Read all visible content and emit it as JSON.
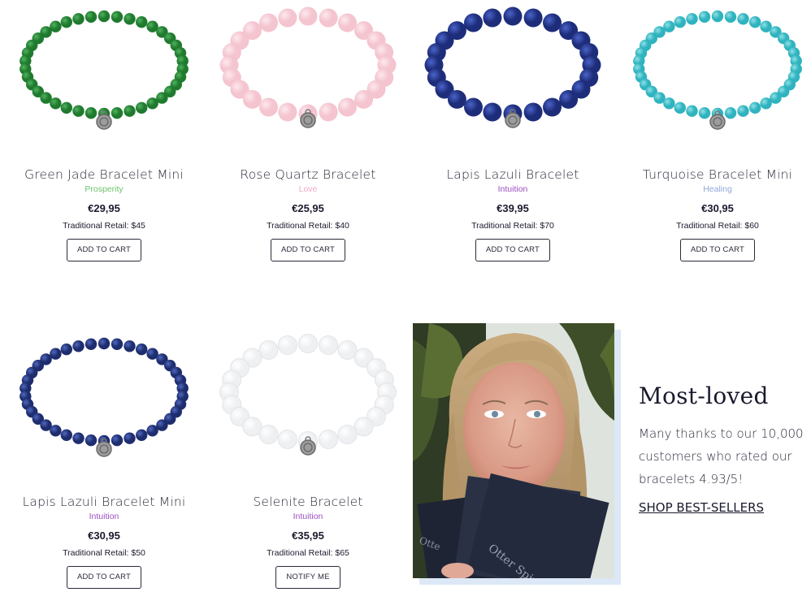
{
  "products": [
    {
      "name": "Green Jade Bracelet Mini",
      "tag": "Prosperity",
      "tag_color": "#6cc36c",
      "price": "€29,95",
      "retail": "Traditional Retail: $45",
      "button": "ADD TO CART",
      "bead_color": "#1f7a2e",
      "bead_hi": "#4fb35f",
      "style": "mini"
    },
    {
      "name": "Rose Quartz Bracelet",
      "tag": "Love",
      "tag_color": "#f2a8c8",
      "price": "€25,95",
      "retail": "Traditional Retail: $40",
      "button": "ADD TO CART",
      "bead_color": "#f4c4cf",
      "bead_hi": "#fde8ee",
      "style": "large"
    },
    {
      "name": "Lapis Lazuli Bracelet",
      "tag": "Intuition",
      "tag_color": "#9b4fc4",
      "price": "€39,95",
      "retail": "Traditional Retail: $70",
      "button": "ADD TO CART",
      "bead_color": "#1e2d7a",
      "bead_hi": "#4a63c8",
      "style": "large"
    },
    {
      "name": "Turquoise Bracelet Mini",
      "tag": "Healing",
      "tag_color": "#8fa8d8",
      "price": "€30,95",
      "retail": "Traditional Retail: $60",
      "button": "ADD TO CART",
      "bead_color": "#2fb3bf",
      "bead_hi": "#8fe1e6",
      "style": "mini"
    },
    {
      "name": "Lapis Lazuli Bracelet Mini",
      "tag": "Intuition",
      "tag_color": "#9b4fc4",
      "price": "€30,95",
      "retail": "Traditional Retail: $50",
      "button": "ADD TO CART",
      "bead_color": "#1e2d6e",
      "bead_hi": "#5068bf",
      "style": "mini"
    },
    {
      "name": "Selenite Bracelet",
      "tag": "Intuition",
      "tag_color": "#9b4fc4",
      "price": "€35,95",
      "retail": "Traditional Retail: $65",
      "button": "NOTIFY ME",
      "bead_color": "#eef0f2",
      "bead_hi": "#ffffff",
      "style": "large"
    }
  ],
  "promo": {
    "title": "Most-loved",
    "text": "Many thanks to our 10,000 customers who rated our bracelets 4.93/5!",
    "link": "SHOP BEST-SELLERS"
  },
  "photo": {
    "card_text": "Otter Spirit",
    "card_text_2": "Otte"
  }
}
